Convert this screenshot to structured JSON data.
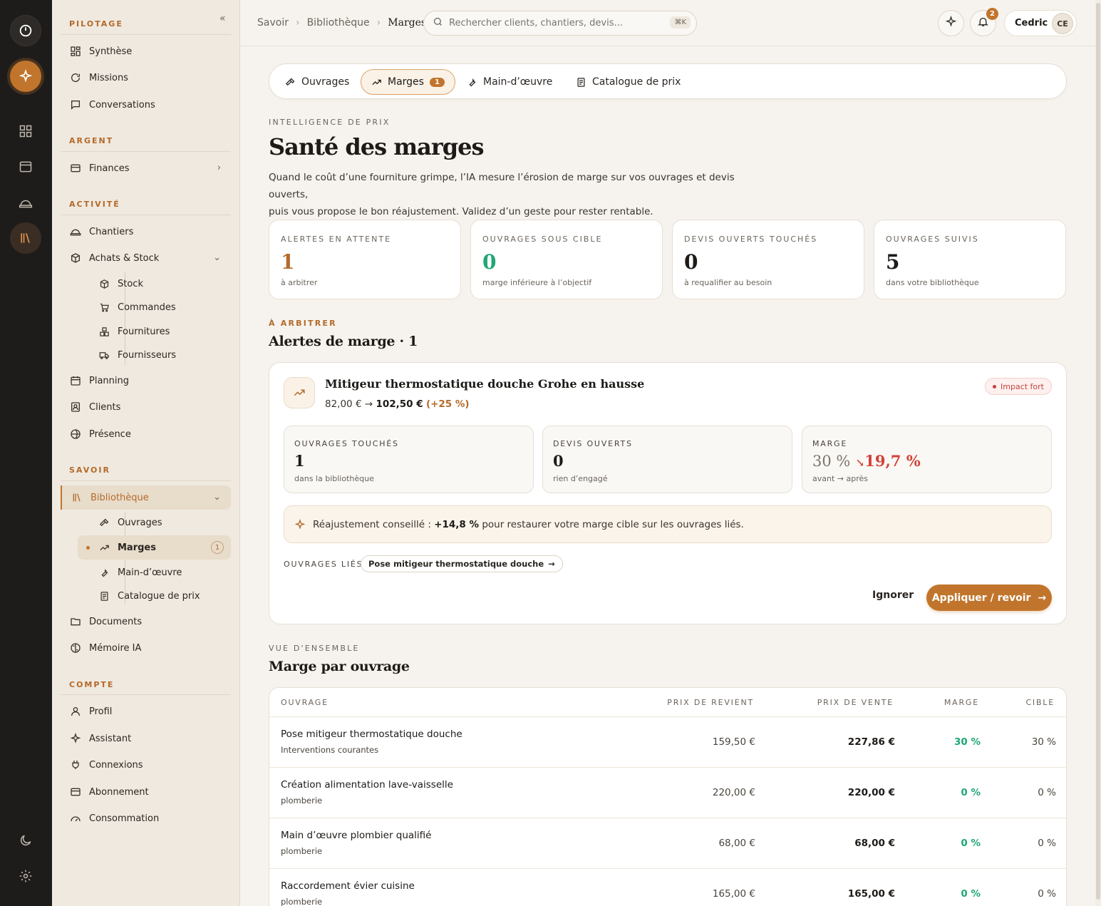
{
  "sidebar": {
    "sections": {
      "pilotage": "PILOTAGE",
      "argent": "ARGENT",
      "activite": "ACTIVITÉ",
      "savoir": "SAVOIR",
      "compte": "COMPTE"
    },
    "items": {
      "synthese": "Synthèse",
      "missions": "Missions",
      "conversations": "Conversations",
      "finances": "Finances",
      "chantiers": "Chantiers",
      "achats": "Achats & Stock",
      "stock": "Stock",
      "commandes": "Commandes",
      "fournitures": "Fournitures",
      "fournisseurs": "Fournisseurs",
      "planning": "Planning",
      "clients": "Clients",
      "presence": "Présence",
      "bibliotheque": "Bibliothèque",
      "ouvrages": "Ouvrages",
      "marges": "Marges",
      "marges_count": "1",
      "main_oeuvre": "Main-d’œuvre",
      "catalogue": "Catalogue de prix",
      "documents": "Documents",
      "memoire": "Mémoire IA",
      "profil": "Profil",
      "assistant": "Assistant",
      "connexions": "Connexions",
      "abonnement": "Abonnement",
      "consommation": "Consommation"
    }
  },
  "topbar": {
    "breadcrumb": [
      "Savoir",
      "Bibliothèque",
      "Marges"
    ],
    "search_placeholder": "Rechercher clients, chantiers, devis...",
    "search_shortcut": "⌘K",
    "notif_count": "2",
    "user_name": "Cedric",
    "user_initials": "CE"
  },
  "tabs": [
    {
      "label": "Ouvrages"
    },
    {
      "label": "Marges",
      "count": "1"
    },
    {
      "label": "Main-d’œuvre"
    },
    {
      "label": "Catalogue de prix"
    }
  ],
  "page": {
    "eyebrow": "INTELLIGENCE DE PRIX",
    "title": "Santé des marges",
    "lead_1": "Quand le coût d’une fourniture grimpe, l’IA mesure l’érosion de marge sur vos ouvrages et devis ouverts,",
    "lead_2": "puis vous propose le bon réajustement. Validez d’un geste pour rester rentable."
  },
  "kpis": [
    {
      "label": "ALERTES EN ATTENTE",
      "value": "1",
      "sub": "à arbitrer",
      "color": "#b36a2a"
    },
    {
      "label": "OUVRAGES SOUS CIBLE",
      "value": "0",
      "sub": "marge inférieure à l’objectif",
      "color": "#1fa774"
    },
    {
      "label": "DEVIS OUVERTS TOUCHÉS",
      "value": "0",
      "sub": "à requalifier au besoin",
      "color": "#1d1a17"
    },
    {
      "label": "OUVRAGES SUIVIS",
      "value": "5",
      "sub": "dans votre bibliothèque",
      "color": "#1d1a17"
    }
  ],
  "alerts_section": {
    "eyebrow": "À ARBITRER",
    "title": "Alertes de marge · 1"
  },
  "alert": {
    "title": "Mitigeur thermostatique douche Grohe en hausse",
    "price_old": "82,00 €",
    "arrow": "→",
    "price_new": "102,50 €",
    "price_delta": "(+25 %)",
    "impact": "Impact fort",
    "mini": [
      {
        "label": "OUVRAGES TOUCHÉS",
        "value": "1",
        "sub": "dans la bibliothèque"
      },
      {
        "label": "DEVIS OUVERTS",
        "value": "0",
        "sub": "rien d’engagé"
      },
      {
        "label": "MARGE",
        "value_old": "30 %",
        "value_new": "19,7 %",
        "sub": "avant → après"
      }
    ],
    "reco_prefix": "Réajustement conseillé :",
    "reco_value": "+14,8 %",
    "reco_suffix": "pour restaurer votre marge cible sur les ouvrages liés.",
    "linked_label": "OUVRAGES LIÉS",
    "linked_chip": "Pose mitigeur thermostatique douche",
    "ignore": "Ignorer",
    "apply": "Appliquer / revoir"
  },
  "overview": {
    "eyebrow": "VUE D'ENSEMBLE",
    "title": "Marge par ouvrage",
    "headers": {
      "ouvrage": "OUVRAGE",
      "revient": "PRIX DE REVIENT",
      "vente": "PRIX DE VENTE",
      "marge": "MARGE",
      "cible": "CIBLE"
    },
    "rows": [
      {
        "name": "Pose mitigeur thermostatique douche",
        "cat": "Interventions courantes",
        "revient": "159,50 €",
        "vente": "227,86 €",
        "marge": "30 %",
        "cible": "30 %"
      },
      {
        "name": "Création alimentation lave-vaisselle",
        "cat": "plomberie",
        "revient": "220,00 €",
        "vente": "220,00 €",
        "marge": "0 %",
        "cible": "0 %"
      },
      {
        "name": "Main d’œuvre plombier qualifié",
        "cat": "plomberie",
        "revient": "68,00 €",
        "vente": "68,00 €",
        "marge": "0 %",
        "cible": "0 %"
      },
      {
        "name": "Raccordement évier cuisine",
        "cat": "plomberie",
        "revient": "165,00 €",
        "vente": "165,00 €",
        "marge": "0 %",
        "cible": "0 %"
      }
    ]
  },
  "colors": {
    "accent": "#c1752c",
    "positive": "#1fa774",
    "negative": "#d2423a"
  }
}
